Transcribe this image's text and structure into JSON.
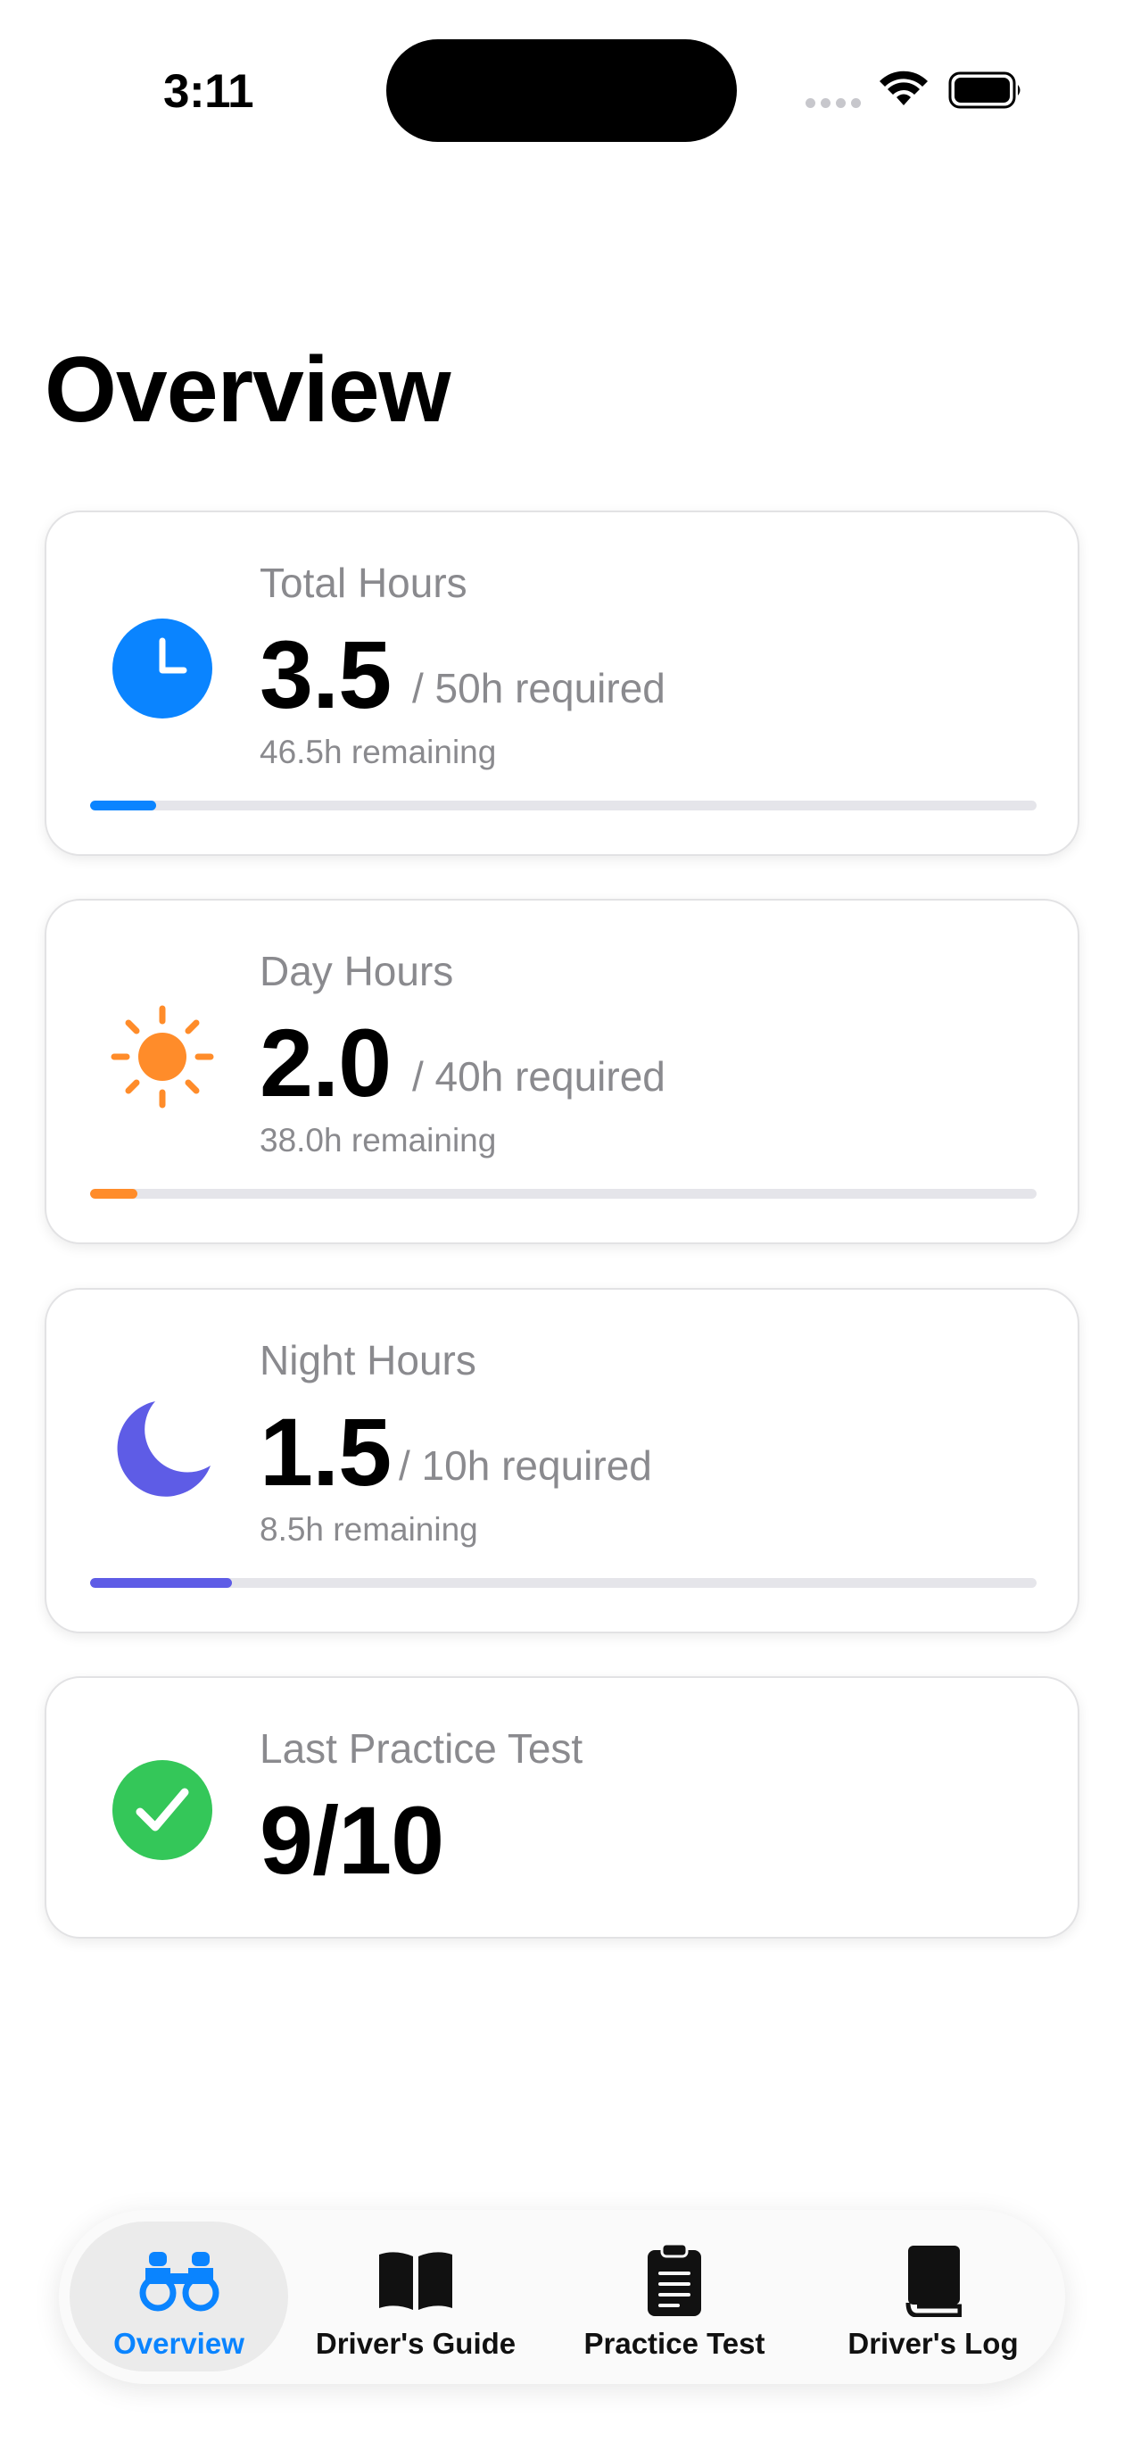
{
  "status_bar": {
    "time": "3:11"
  },
  "header": {
    "title": "Overview"
  },
  "cards": [
    {
      "label": "Total Hours",
      "value": "3.5",
      "required": "/ 50h required",
      "remaining": "46.5h remaining",
      "icon": "clock-icon",
      "color": "#0a84ff",
      "progress": 0.07
    },
    {
      "label": "Day Hours",
      "value": "2.0",
      "required": "/ 40h required",
      "remaining": "38.0h remaining",
      "icon": "sun-icon",
      "color": "#ff8c2a",
      "progress": 0.05
    },
    {
      "label": "Night Hours",
      "value": "1.5",
      "required": "/ 10h required",
      "remaining": "8.5h remaining",
      "icon": "moon-icon",
      "color": "#5e5ce6",
      "progress": 0.15
    },
    {
      "label": "Last Practice Test",
      "value": "9/10",
      "icon": "checkmark-circle-icon",
      "color": "#34c759"
    }
  ],
  "tab_bar": {
    "active_color": "#0a84ff",
    "tabs": [
      {
        "label": "Overview",
        "icon": "binoculars-icon",
        "active": true
      },
      {
        "label": "Driver's Guide",
        "icon": "book-open-icon",
        "active": false
      },
      {
        "label": "Practice Test",
        "icon": "clipboard-icon",
        "active": false
      },
      {
        "label": "Driver's Log",
        "icon": "book-closed-icon",
        "active": false
      }
    ]
  }
}
